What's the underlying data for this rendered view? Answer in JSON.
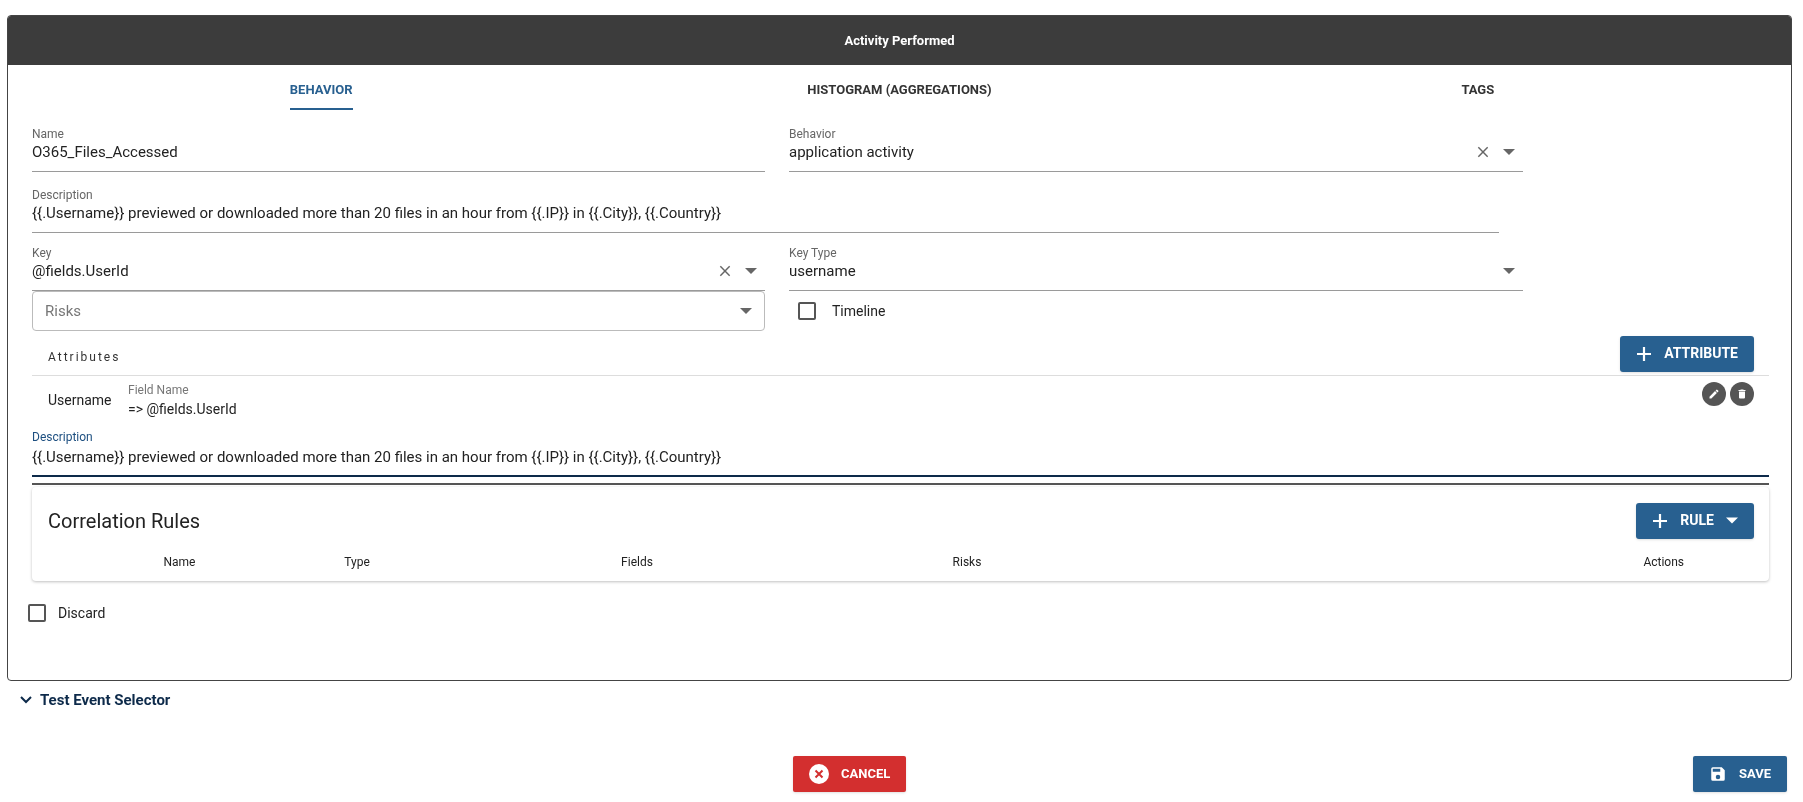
{
  "window": {
    "title": "Activity Performed"
  },
  "tabs": [
    {
      "label": "BEHAVIOR",
      "selected": true
    },
    {
      "label": "HISTOGRAM (AGGREGATIONS)",
      "selected": false
    },
    {
      "label": "TAGS",
      "selected": false
    }
  ],
  "name_field": {
    "label": "Name",
    "value": "O365_Files_Accessed"
  },
  "behavior_field": {
    "label": "Behavior",
    "value": "application activity"
  },
  "description_field": {
    "label": "Description",
    "value": "{{.Username}} previewed or downloaded more than 20 files in an hour from {{.IP}} in {{.City}}, {{.Country}}"
  },
  "key_field": {
    "label": "Key",
    "value": "@fields.UserId"
  },
  "key_type_field": {
    "label": "Key Type",
    "value": "username"
  },
  "risks_field": {
    "placeholder": "Risks"
  },
  "timeline": {
    "label": "Timeline",
    "checked": false
  },
  "attributes": {
    "title": "Attributes",
    "add_button": "ATTRIBUTE",
    "items": [
      {
        "name": "Username",
        "field_label": "Field Name",
        "field_value": "=> @fields.UserId"
      }
    ]
  },
  "attribute_description": {
    "label": "Description",
    "value": "{{.Username}} previewed or downloaded more than 20 files in an hour from {{.IP}} in {{.City}}, {{.Country}}"
  },
  "correlation_rules": {
    "title": "Correlation Rules",
    "add_button": "RULE",
    "columns": [
      "Name",
      "Type",
      "Fields",
      "Risks",
      "Actions"
    ]
  },
  "discard": {
    "label": "Discard",
    "checked": false
  },
  "test_event_selector": {
    "label": "Test Event Selector"
  },
  "buttons": [
    {
      "kind": "cancel",
      "label": "CANCEL"
    },
    {
      "kind": "save",
      "label": "SAVE"
    }
  ]
}
